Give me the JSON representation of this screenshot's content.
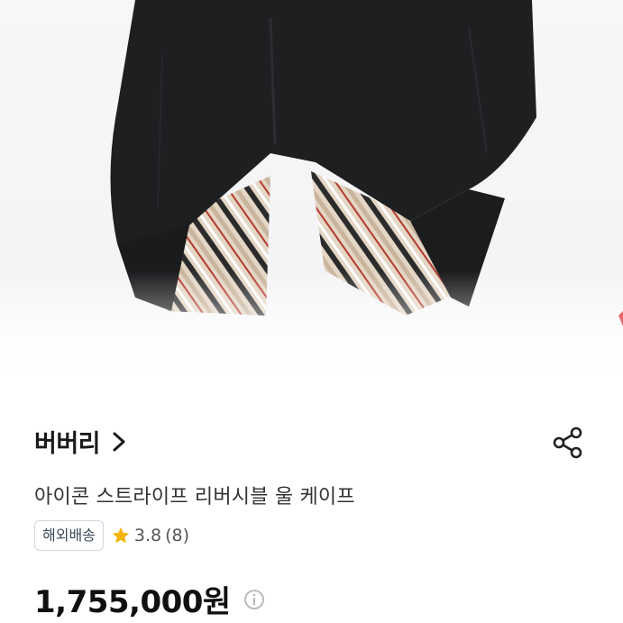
{
  "product": {
    "brand": "버버리",
    "title": "아이콘 스트라이프 리버시블 울 케이프",
    "badge": "해외배송",
    "rating": {
      "score": "3.8",
      "count_text": "(8)"
    },
    "price": "1,755,000원"
  },
  "icons": {
    "brand_chevron": "chevron-right-icon",
    "share": "share-icon",
    "star": "star-icon",
    "info": "info-icon"
  },
  "colors": {
    "star": "#f5b301",
    "cape": "#1e1f21",
    "lining_check": "#d9c7b1"
  }
}
